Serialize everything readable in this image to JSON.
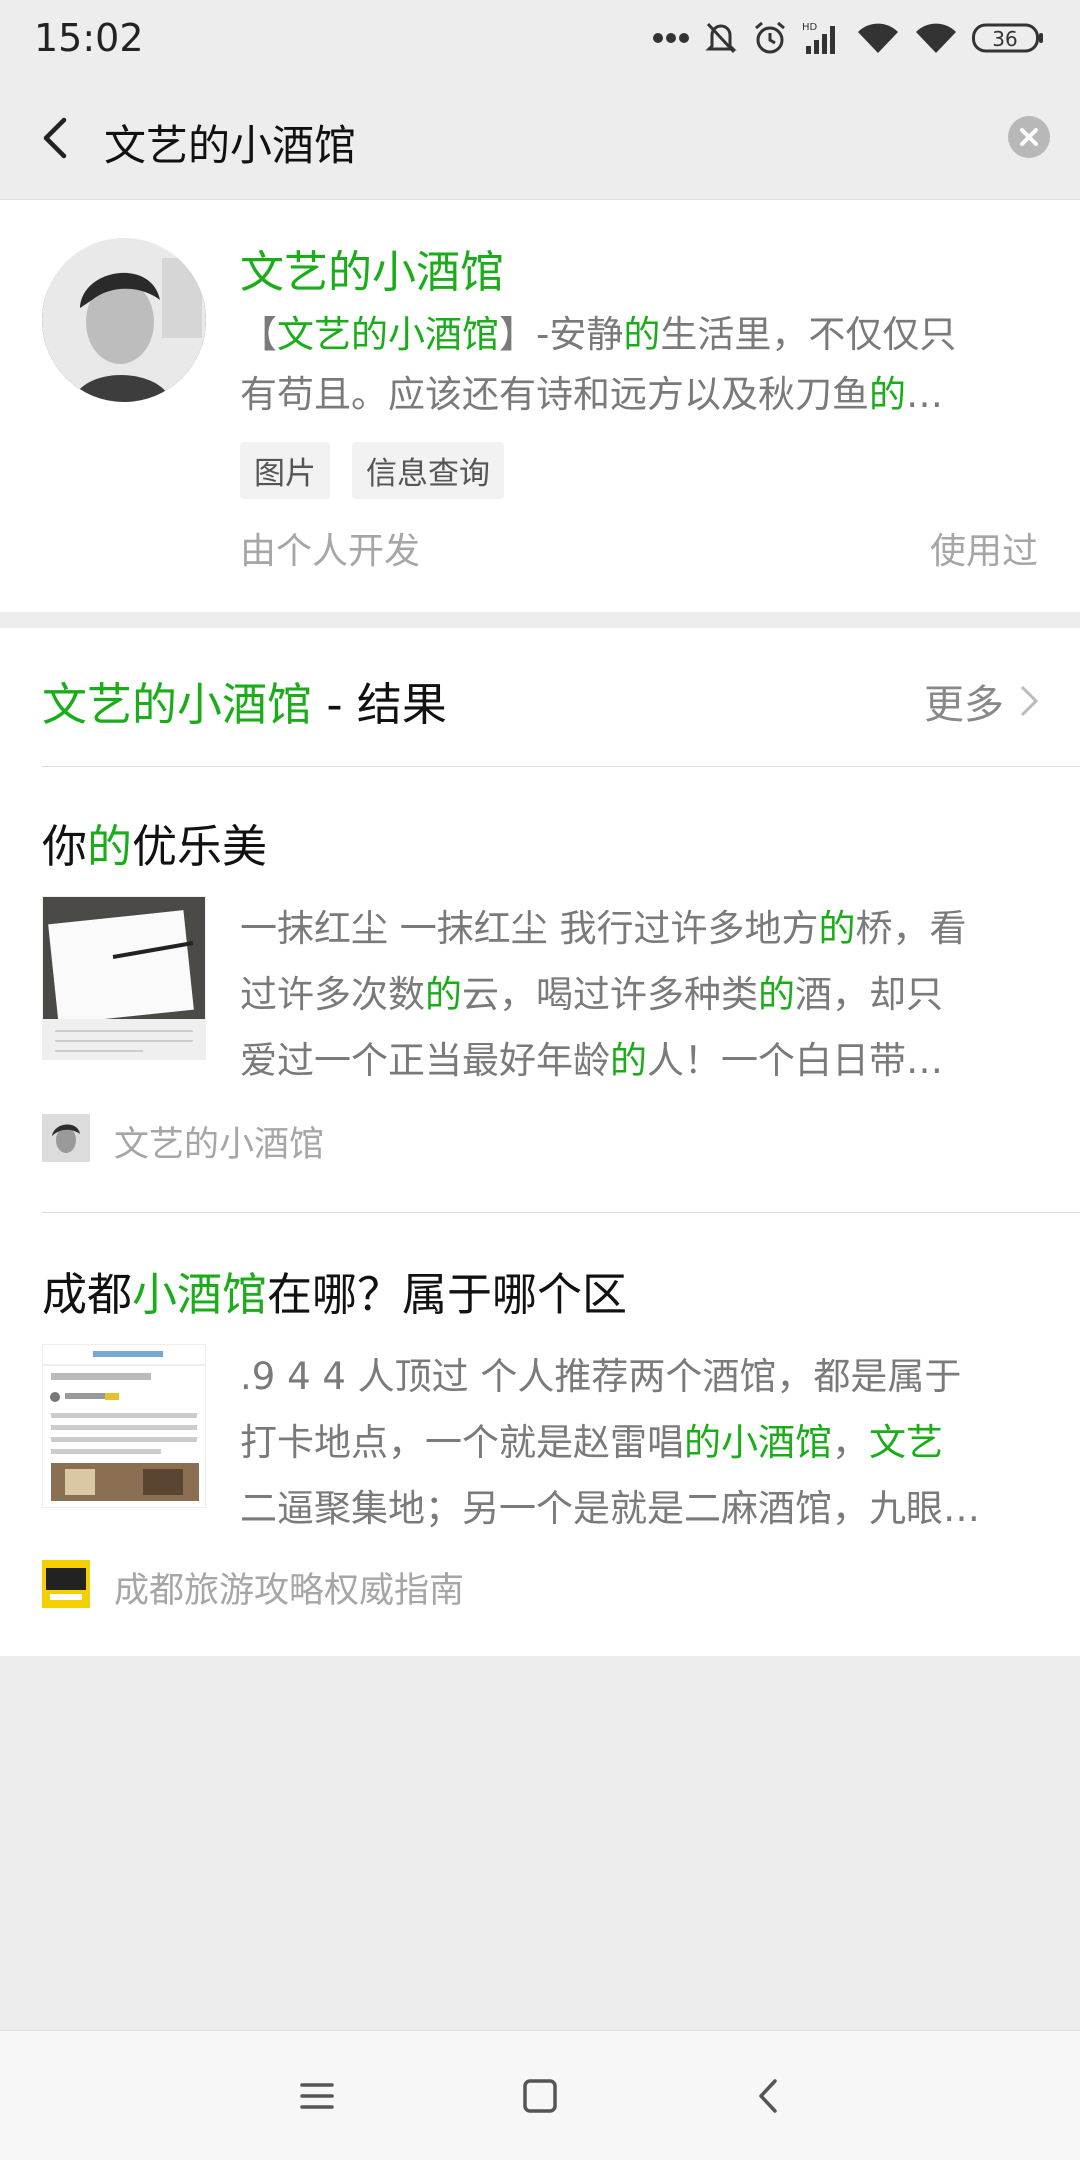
{
  "status_bar": {
    "time": "15:02",
    "battery": "36"
  },
  "nav": {
    "search_query": "文艺的小酒馆"
  },
  "app_card": {
    "name": "文艺的小酒馆",
    "desc_line1_pre": "【",
    "desc_line1_hl": "文艺的小酒馆",
    "desc_line1_mid": "】-安静",
    "desc_line1_hl2": "的",
    "desc_line1_post": "生活里，不仅仅只",
    "desc_line2_pre": "有苟且。应该还有诗和远方以及秋刀鱼",
    "desc_line2_hl": "的",
    "desc_line2_post": "…",
    "tags": [
      "图片",
      "信息查询"
    ],
    "developer": "由个人开发",
    "used_label": "使用过"
  },
  "results": {
    "header_hl": "文艺的小酒馆",
    "header_rest": " - 结果",
    "more_label": "更多",
    "articles": [
      {
        "title_pre": "你",
        "title_hl": "的",
        "title_post": "优乐美",
        "body": [
          {
            "pre": "一抹红尘 一抹红尘 我行过许多地方",
            "hl": "的",
            "post": "桥，看"
          },
          {
            "pre": "过许多次数",
            "hl": "的",
            "post": "云，喝过许多种类",
            "hl2": "的",
            "post2": "酒，却只"
          },
          {
            "pre": "爱过一个正当最好年龄",
            "hl": "的",
            "post": "人！一个白日带…"
          }
        ],
        "source": "文艺的小酒馆"
      },
      {
        "title_pre": "成都",
        "title_hl": "小酒馆",
        "title_post": "在哪？属于哪个区",
        "body": [
          {
            "pre": ".9 4 4 人顶过 个人推荐两个酒馆，都是属于",
            "hl": "",
            "post": ""
          },
          {
            "pre": "打卡地点，一个就是赵雷唱",
            "hl": "的小酒馆",
            "post": "，",
            "hl2": "文艺",
            "post2": ""
          },
          {
            "pre": "二逼聚集地；另一个是就是二麻酒馆，九眼…",
            "hl": "",
            "post": ""
          }
        ],
        "source": "成都旅游攻略权威指南"
      }
    ]
  },
  "colors": {
    "accent": "#1aad19",
    "muted": "#a6a6a6"
  }
}
